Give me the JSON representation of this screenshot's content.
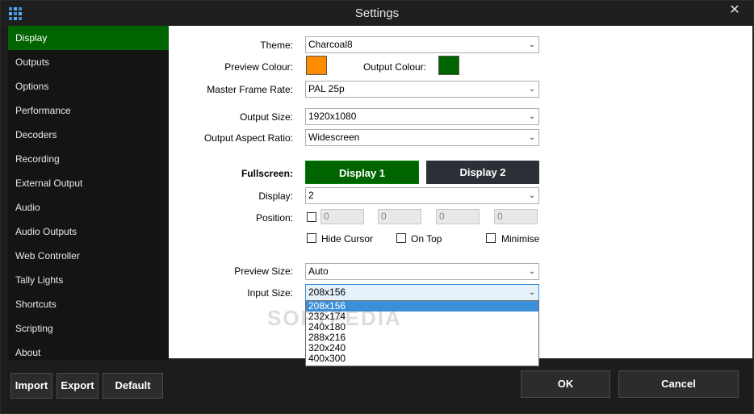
{
  "window": {
    "title": "Settings",
    "close_glyph": "✕"
  },
  "sidebar": {
    "items": [
      {
        "label": "Display",
        "active": true
      },
      {
        "label": "Outputs"
      },
      {
        "label": "Options"
      },
      {
        "label": "Performance"
      },
      {
        "label": "Decoders"
      },
      {
        "label": "Recording"
      },
      {
        "label": "External Output"
      },
      {
        "label": "Audio"
      },
      {
        "label": "Audio Outputs"
      },
      {
        "label": "Web Controller"
      },
      {
        "label": "Tally Lights"
      },
      {
        "label": "Shortcuts"
      },
      {
        "label": "Scripting"
      },
      {
        "label": "About"
      }
    ],
    "import_label": "Import",
    "export_label": "Export",
    "default_label": "Default"
  },
  "form": {
    "theme_label": "Theme:",
    "theme_value": "Charcoal8",
    "preview_colour_label": "Preview Colour:",
    "preview_colour": "#ff8c00",
    "output_colour_label": "Output Colour:",
    "output_colour": "#006400",
    "master_frame_rate_label": "Master Frame Rate:",
    "master_frame_rate_value": "PAL 25p",
    "output_size_label": "Output Size:",
    "output_size_value": "1920x1080",
    "aspect_label": "Output Aspect Ratio:",
    "aspect_value": "Widescreen",
    "fullscreen_label": "Fullscreen:",
    "display1_label": "Display 1",
    "display2_label": "Display 2",
    "display_label": "Display:",
    "display_value": "2",
    "position_label": "Position:",
    "position_values": [
      "0",
      "0",
      "0",
      "0"
    ],
    "hide_cursor_label": "Hide Cursor",
    "on_top_label": "On Top",
    "minimise_label": "Minimise",
    "preview_size_label": "Preview Size:",
    "preview_size_value": "Auto",
    "input_size_label": "Input Size:",
    "input_size_value": "208x156",
    "input_size_options": [
      "208x156",
      "232x174",
      "240x180",
      "288x216",
      "320x240",
      "400x300"
    ]
  },
  "footer": {
    "ok_label": "OK",
    "cancel_label": "Cancel"
  },
  "watermark": "SOFTPEDIA",
  "colors": {
    "active_green": "#006400",
    "display2_bg": "#2b2f36",
    "select_highlight": "#3b8ed8"
  }
}
